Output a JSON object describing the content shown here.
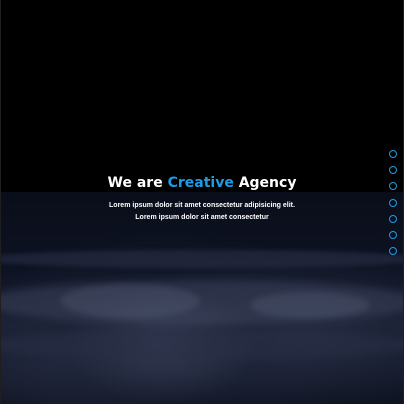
{
  "hero": {
    "title_before": "We are ",
    "title_accent": "Creative",
    "title_after": " Agency",
    "subtitle_line1": "Lorem ipsum dolor sit amet consectetur adipisicing elit.",
    "subtitle_line2": "Lorem ipsum dolor sit amet consectetur"
  },
  "slider_nav": {
    "count": 7
  },
  "colors": {
    "accent": "#1e9be6",
    "background": "#000000",
    "image_tint": "#12172a",
    "text": "#ffffff"
  }
}
